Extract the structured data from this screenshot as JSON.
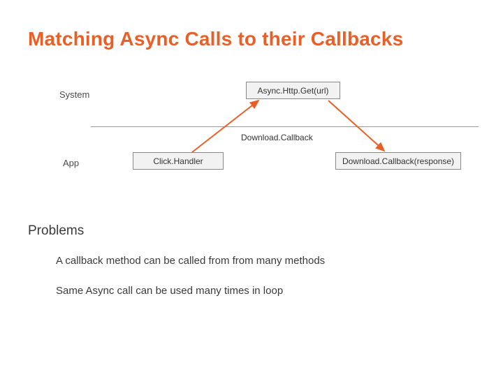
{
  "title": "Matching Async Calls to their Callbacks",
  "labels": {
    "system": "System",
    "app": "App",
    "callback": "Download.Callback"
  },
  "boxes": {
    "async_get": "Async.Http.Get(url)",
    "click_handler": "Click.Handler",
    "download_resp": "Download.Callback(response)"
  },
  "problems": {
    "heading": "Problems",
    "items": [
      "A callback method can be called from from many methods",
      "Same Async call can be used many times in loop"
    ]
  }
}
